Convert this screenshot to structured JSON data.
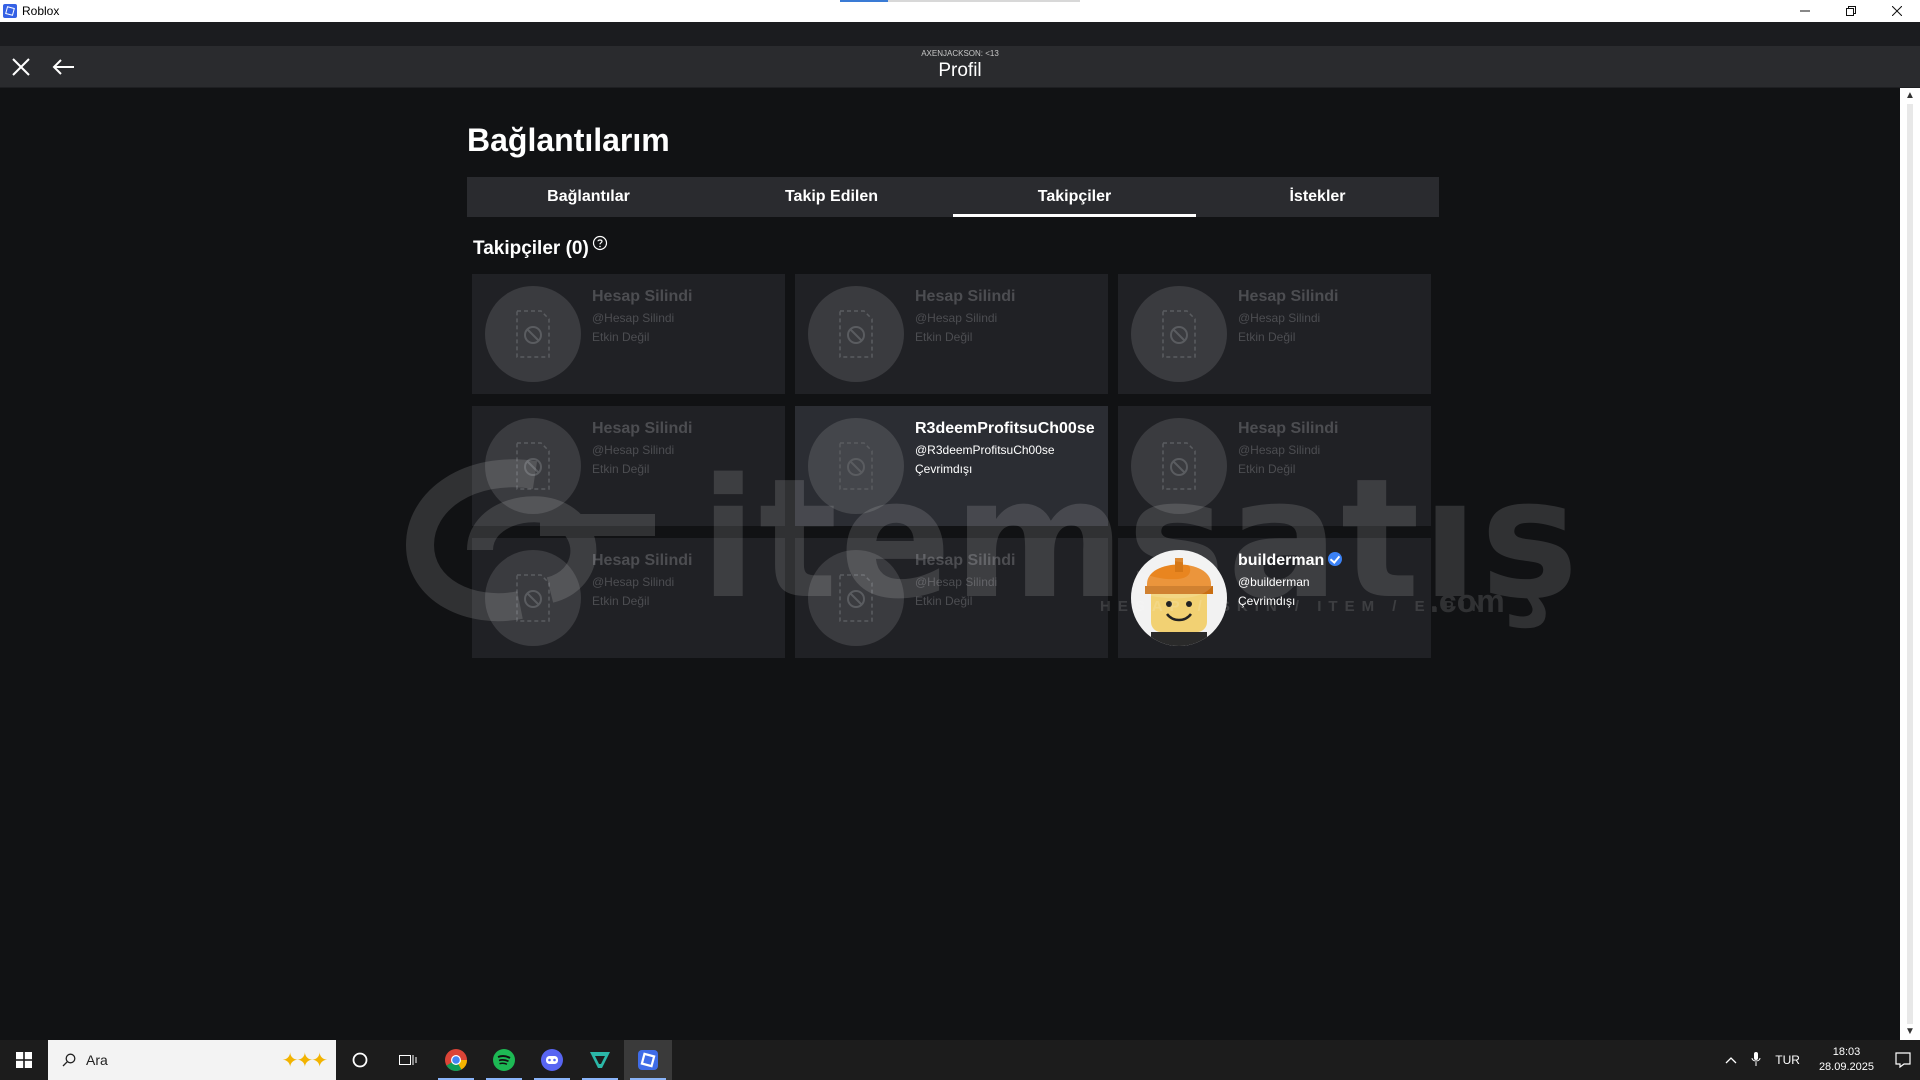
{
  "window": {
    "title": "Roblox",
    "controls": [
      "minimize",
      "restore",
      "close"
    ]
  },
  "header": {
    "subtitle": "AXENJACKSON: <13",
    "title": "Profil"
  },
  "page": {
    "heading": "Bağlantılarım"
  },
  "tabs": [
    {
      "label": "Bağlantılar",
      "active": false
    },
    {
      "label": "Takip Edilen",
      "active": false
    },
    {
      "label": "Takipçiler",
      "active": true
    },
    {
      "label": "İstekler",
      "active": false
    }
  ],
  "section": {
    "title": "Takipçiler (0)"
  },
  "cards": [
    {
      "name": "Hesap Silindi",
      "username": "@Hesap Silindi",
      "status": "Etkin Değil",
      "deleted": true
    },
    {
      "name": "Hesap Silindi",
      "username": "@Hesap Silindi",
      "status": "Etkin Değil",
      "deleted": true
    },
    {
      "name": "Hesap Silindi",
      "username": "@Hesap Silindi",
      "status": "Etkin Değil",
      "deleted": true
    },
    {
      "name": "Hesap Silindi",
      "username": "@Hesap Silindi",
      "status": "Etkin Değil",
      "deleted": true
    },
    {
      "name": "R3deemProfitsuCh00se",
      "username": "@R3deemProfitsuCh00se",
      "status": "Çevrimdışı",
      "deleted": false
    },
    {
      "name": "Hesap Silindi",
      "username": "@Hesap Silindi",
      "status": "Etkin Değil",
      "deleted": true
    },
    {
      "name": "Hesap Silindi",
      "username": "@Hesap Silindi",
      "status": "Etkin Değil",
      "deleted": true
    },
    {
      "name": "Hesap Silindi",
      "username": "@Hesap Silindi",
      "status": "Etkin Değil",
      "deleted": true
    },
    {
      "name": "builderman",
      "username": "@builderman",
      "status": "Çevrimdışı",
      "deleted": false,
      "verified": true
    }
  ],
  "watermark": {
    "text": "itemsatış",
    "sub": "HESAP / SKIN / ITEM / E-PIN",
    "domain": ".com"
  },
  "taskbar": {
    "search_placeholder": "Ara",
    "apps": [
      "chrome-icon",
      "spotify-icon",
      "discord-icon",
      "vpn-icon",
      "roblox-icon"
    ],
    "language": "TUR",
    "time": "18:03",
    "date": "28.09.2025"
  },
  "colors": {
    "background": "#111214",
    "header": "#2a2b2e",
    "card": "#202125",
    "verified": "#3b82f6"
  }
}
